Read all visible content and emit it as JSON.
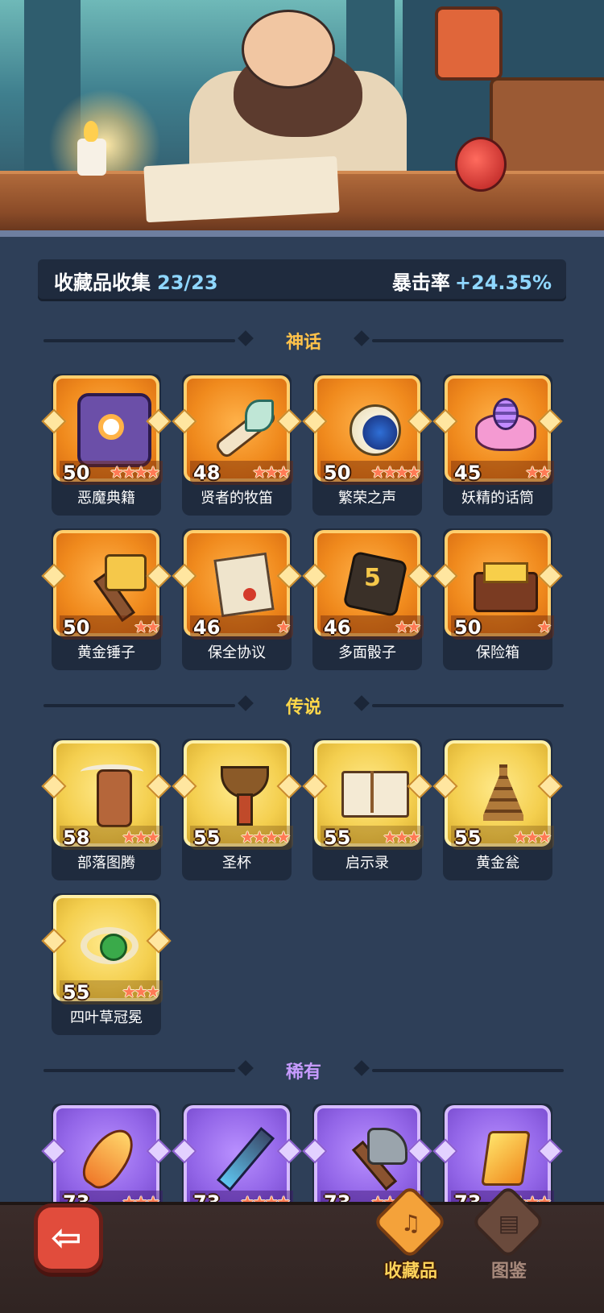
{
  "stats": {
    "collection_label": "收藏品收集",
    "collection_value": "23/23",
    "crit_label": "暴击率",
    "crit_value": "+24.35%"
  },
  "sections": [
    {
      "title": "神话",
      "color": "#ffc24a",
      "items": [
        {
          "name": "恶魔典籍",
          "level": "50",
          "stars": "★★★★",
          "icon": "demon-book-icon"
        },
        {
          "name": "贤者的牧笛",
          "level": "48",
          "stars": "★★★",
          "icon": "sage-flute-icon"
        },
        {
          "name": "繁荣之声",
          "level": "50",
          "stars": "★★★★",
          "icon": "shell-icon"
        },
        {
          "name": "妖精的话筒",
          "level": "45",
          "stars": "★★",
          "icon": "fairy-microphone-icon"
        },
        {
          "name": "黄金锤子",
          "level": "50",
          "stars": "★★",
          "icon": "golden-hammer-icon"
        },
        {
          "name": "保全协议",
          "level": "46",
          "stars": "★",
          "icon": "contract-icon"
        },
        {
          "name": "多面骰子",
          "level": "46",
          "stars": "★★",
          "icon": "dice-icon"
        },
        {
          "name": "保险箱",
          "level": "50",
          "stars": "★",
          "icon": "treasure-chest-icon"
        }
      ]
    },
    {
      "title": "传说",
      "color": "#ffd84a",
      "items": [
        {
          "name": "部落图腾",
          "level": "58",
          "stars": "★★★",
          "icon": "totem-icon"
        },
        {
          "name": "圣杯",
          "level": "55",
          "stars": "★★★★",
          "icon": "grail-icon"
        },
        {
          "name": "启示录",
          "level": "55",
          "stars": "★★★",
          "icon": "open-book-icon"
        },
        {
          "name": "黄金瓮",
          "level": "55",
          "stars": "★★★",
          "icon": "golden-urn-icon"
        },
        {
          "name": "四叶草冠冕",
          "level": "55",
          "stars": "★★★",
          "icon": "clover-crown-icon"
        }
      ]
    },
    {
      "title": "稀有",
      "color": "#c79bff",
      "items": [
        {
          "name": "",
          "level": "73",
          "stars": "★★★",
          "icon": "phoenix-feather-icon"
        },
        {
          "name": "",
          "level": "73",
          "stars": "★★★★",
          "icon": "ice-dagger-icon"
        },
        {
          "name": "",
          "level": "73",
          "stars": "★★★★",
          "icon": "stone-axe-icon"
        },
        {
          "name": "",
          "level": "73",
          "stars": "★★★",
          "icon": "lightning-gem-icon"
        }
      ]
    }
  ],
  "nav": {
    "collectibles_label": "收藏品",
    "guide_label": "图鉴",
    "collectibles_icon": "drum-icon",
    "guide_icon": "book-icon",
    "back_icon": "back-arrow-icon"
  }
}
